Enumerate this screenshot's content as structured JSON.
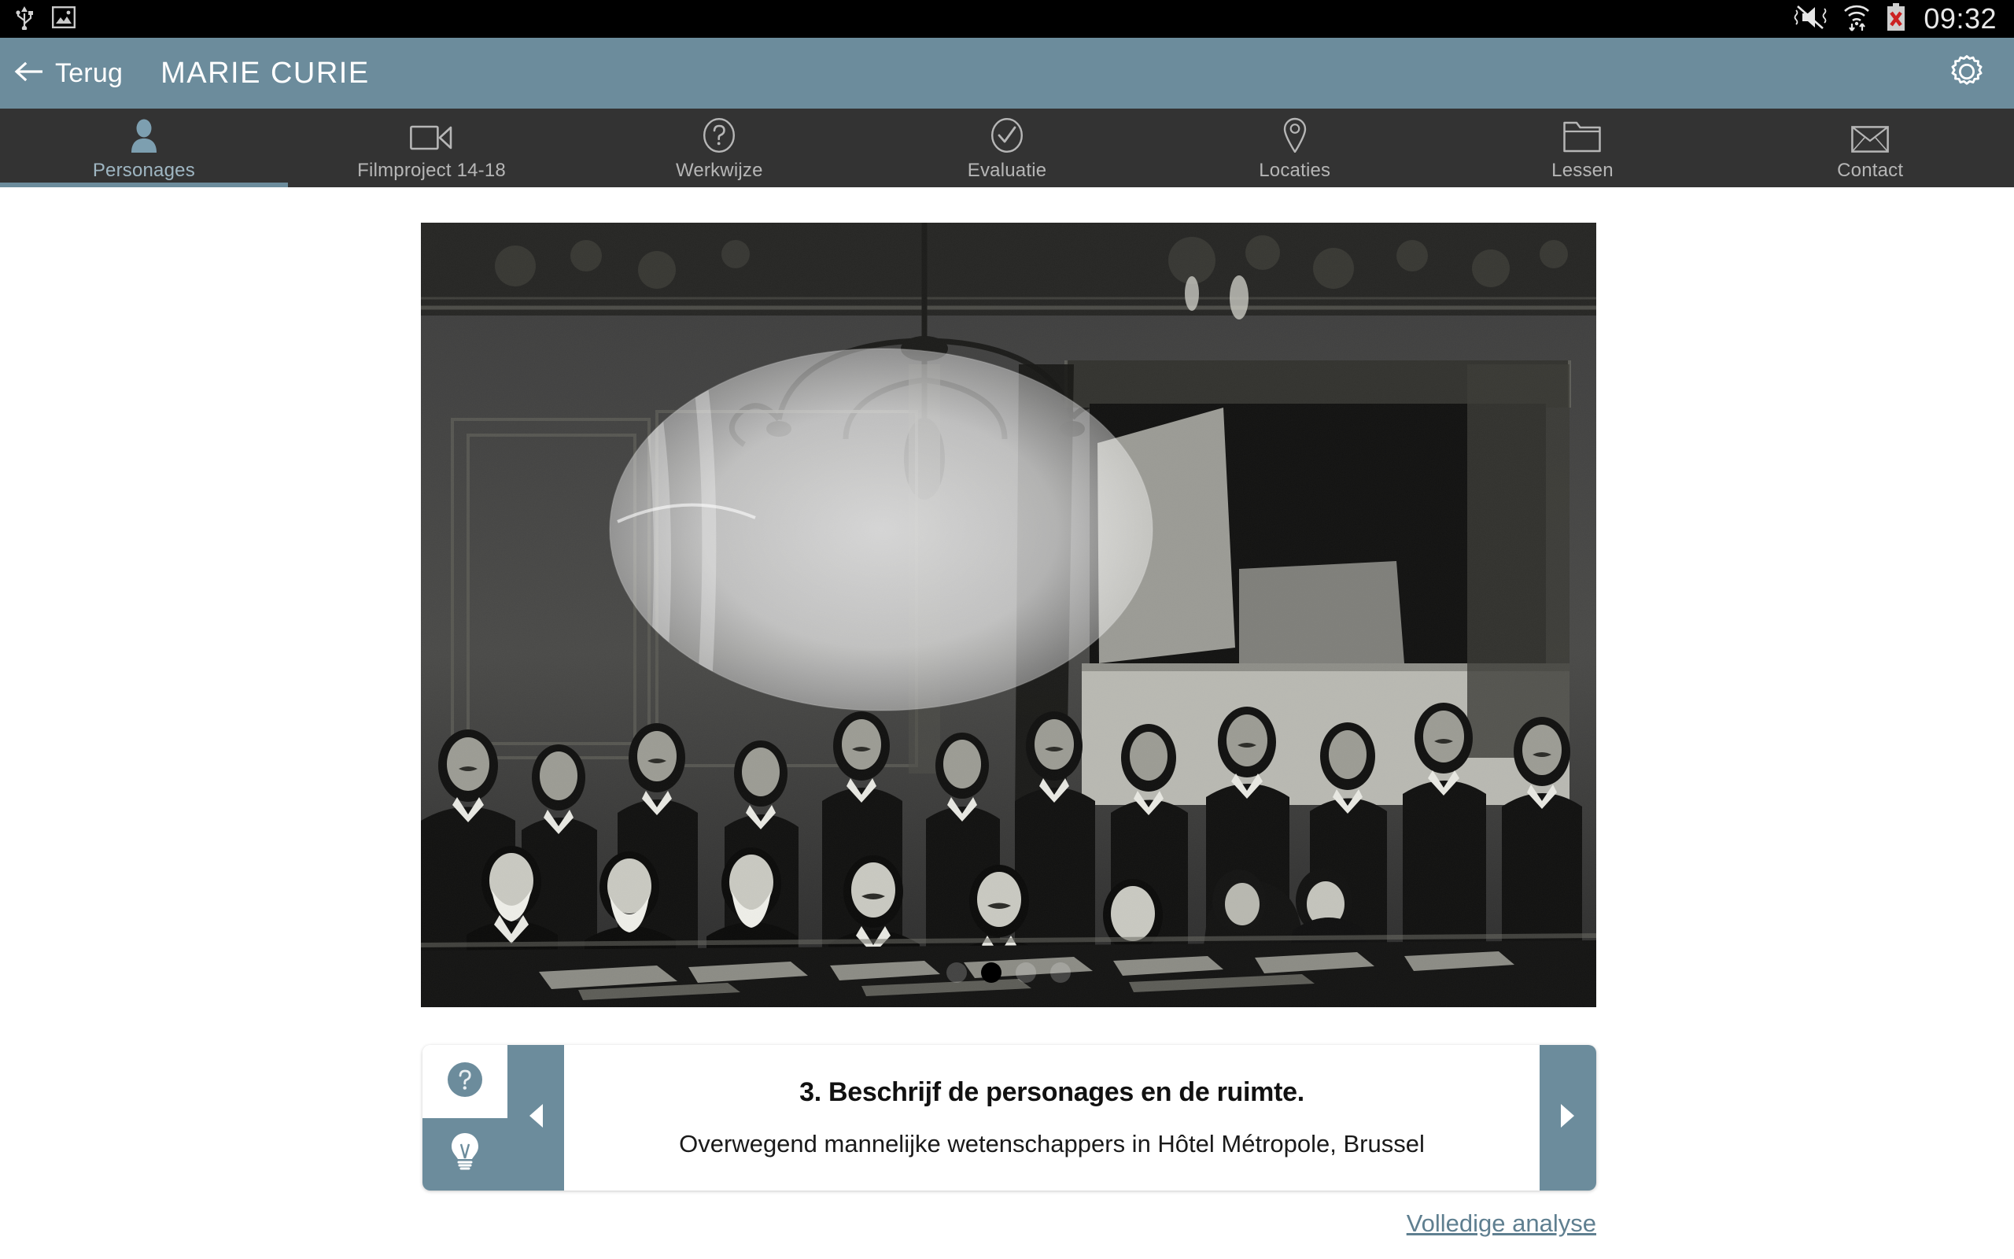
{
  "statusbar": {
    "icons_left": [
      "usb-icon",
      "screenshot-image-icon"
    ],
    "icons_right": [
      "mute-vibrate-icon",
      "wifi-transfer-icon",
      "battery-error-icon"
    ],
    "time": "09:32"
  },
  "appbar": {
    "back_label": "Terug",
    "title": "MARIE CURIE",
    "settings_icon": "gear-icon"
  },
  "tabs": [
    {
      "label": "Personages",
      "icon": "person-icon",
      "active": true
    },
    {
      "label": "Filmproject 14-18",
      "icon": "video-camera-icon",
      "active": false
    },
    {
      "label": "Werkwijze",
      "icon": "question-circle-icon",
      "active": false
    },
    {
      "label": "Evaluatie",
      "icon": "check-circle-icon",
      "active": false
    },
    {
      "label": "Locaties",
      "icon": "map-pin-icon",
      "active": false
    },
    {
      "label": "Lessen",
      "icon": "folder-icon",
      "active": false
    },
    {
      "label": "Contact",
      "icon": "envelope-icon",
      "active": false
    }
  ],
  "photo": {
    "description": "Zwart-wit historische foto van wetenschappers rond een tafel in een zaal met luchter, met een ovale uitlichting over een groep personages",
    "dots_total": 4,
    "dots_active_index": 1
  },
  "caption": {
    "question_icon": "question-mark-icon",
    "hint_icon": "lightbulb-icon",
    "prev_icon": "chevron-left-icon",
    "next_icon": "chevron-right-icon",
    "title": "3. Beschrijf de personages en de ruimte.",
    "subtitle": "Overwegend mannelijke wetenschappers in Hôtel Métropole, Brussel"
  },
  "footer": {
    "analysis_link": "Volledige analyse"
  },
  "colors": {
    "accent": "#6c8c9c",
    "tabbar_bg": "#333333",
    "statusbar_bg": "#000000",
    "tab_label": "#b6b6b6",
    "active_tab_label": "#9fb6c2",
    "link": "#5f7f90"
  }
}
